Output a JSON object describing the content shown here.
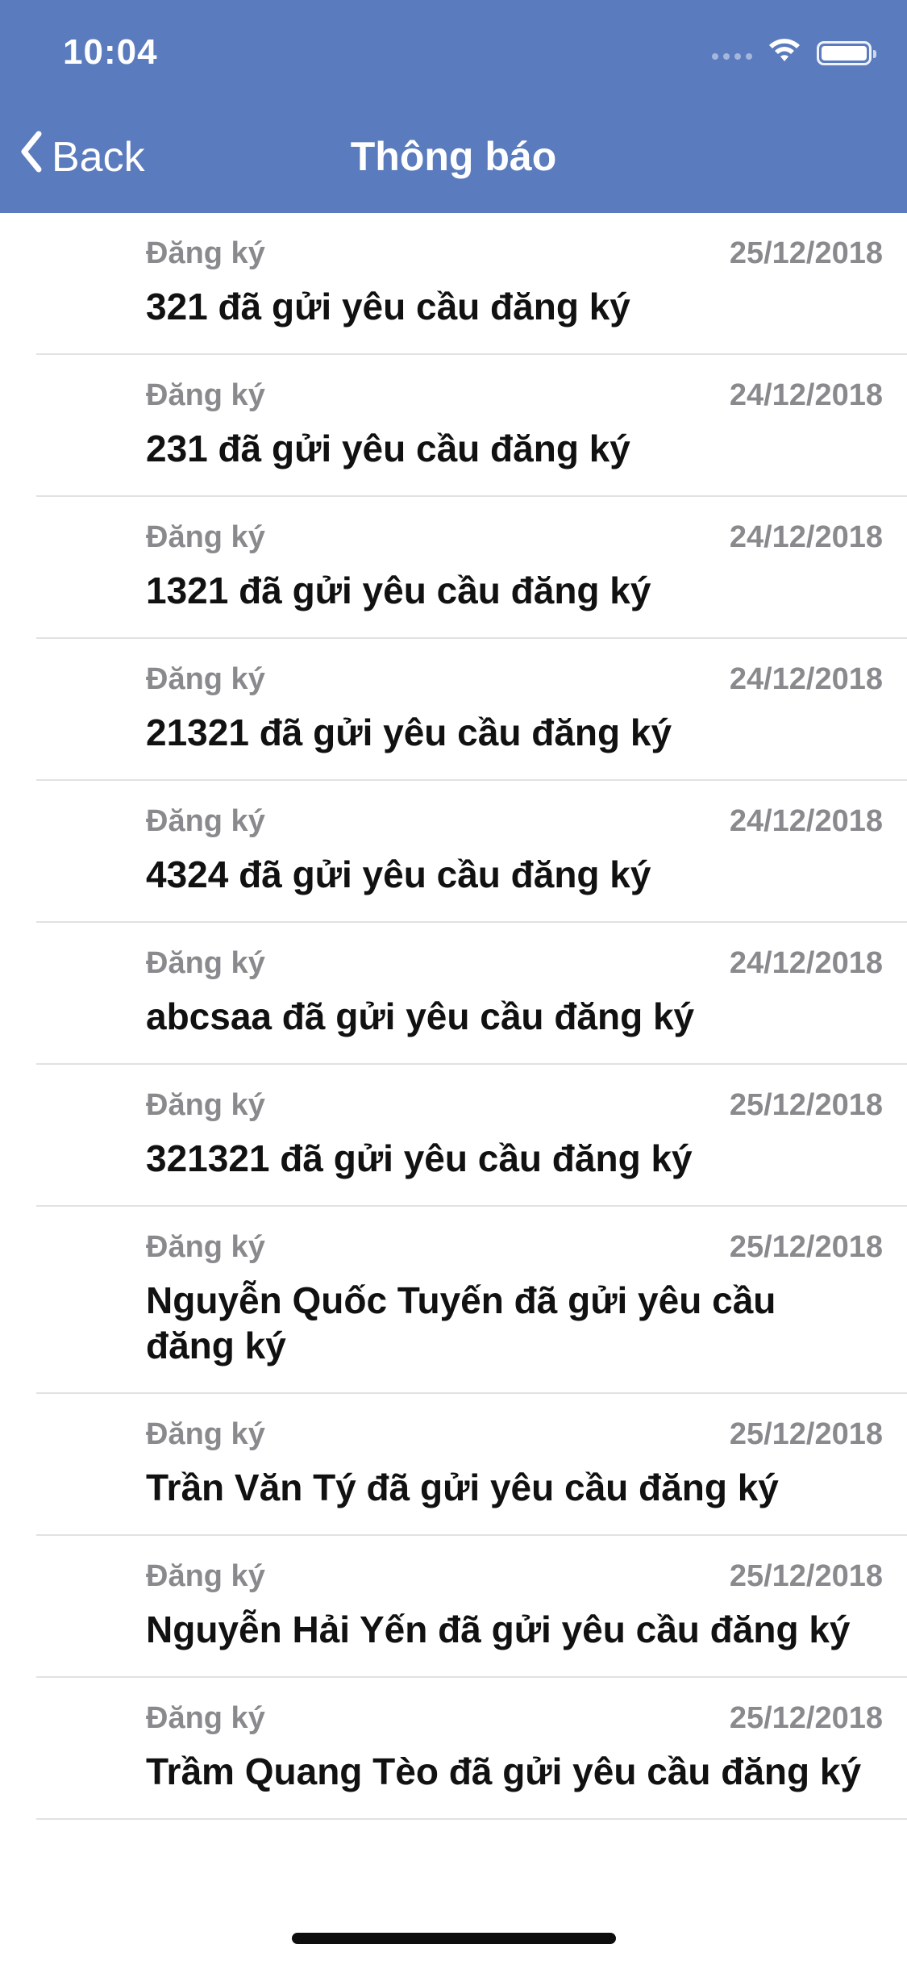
{
  "status_bar": {
    "time": "10:04"
  },
  "nav": {
    "back_label": "Back",
    "title": "Thông báo"
  },
  "colors": {
    "nav_background": "#5a7bbd",
    "secondary_text": "#8a8a8e",
    "primary_text": "#111111"
  },
  "icons": {
    "back": "chevron-left-icon",
    "wifi": "wifi-icon",
    "battery": "battery-icon",
    "signal": "signal-icon"
  },
  "notifications": [
    {
      "category": "Đăng ký",
      "date": "25/12/2018",
      "message": "321 đã gửi yêu cầu đăng ký"
    },
    {
      "category": "Đăng ký",
      "date": "24/12/2018",
      "message": "231 đã gửi yêu cầu đăng ký"
    },
    {
      "category": "Đăng ký",
      "date": "24/12/2018",
      "message": "1321 đã gửi yêu cầu đăng ký"
    },
    {
      "category": "Đăng ký",
      "date": "24/12/2018",
      "message": "21321 đã gửi yêu cầu đăng ký"
    },
    {
      "category": "Đăng ký",
      "date": "24/12/2018",
      "message": "4324 đã gửi yêu cầu đăng ký"
    },
    {
      "category": "Đăng ký",
      "date": "24/12/2018",
      "message": "abcsaa đã gửi yêu cầu đăng ký"
    },
    {
      "category": "Đăng ký",
      "date": "25/12/2018",
      "message": "321321 đã gửi yêu cầu đăng ký"
    },
    {
      "category": "Đăng ký",
      "date": "25/12/2018",
      "message": "Nguyễn Quốc Tuyến đã gửi yêu cầu đăng ký"
    },
    {
      "category": "Đăng ký",
      "date": "25/12/2018",
      "message": "Trần Văn Tý đã gửi yêu cầu đăng ký"
    },
    {
      "category": "Đăng ký",
      "date": "25/12/2018",
      "message": "Nguyễn Hải Yến đã gửi yêu cầu đăng ký"
    },
    {
      "category": "Đăng ký",
      "date": "25/12/2018",
      "message": "Trầm Quang Tèo đã gửi yêu cầu đăng ký"
    }
  ]
}
